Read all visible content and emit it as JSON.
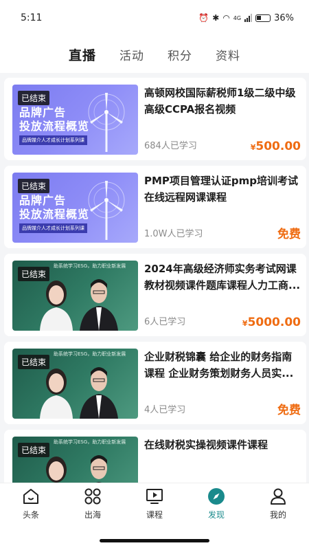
{
  "status": {
    "time": "5:11",
    "battery": "36%",
    "network": "4G"
  },
  "tabs": [
    {
      "label": "直播",
      "active": true
    },
    {
      "label": "活动",
      "active": false
    },
    {
      "label": "积分",
      "active": false
    },
    {
      "label": "资料",
      "active": false
    }
  ],
  "courses": [
    {
      "badge": "已结束",
      "thumb": {
        "style": "purple",
        "line1": "品牌广告",
        "line2": "投放流程概览",
        "sub": "品牌媒介人才成长计划系列课"
      },
      "title": "高顿网校国际薪税师1级二级中级高级CCPA报名视频",
      "learners": "684人已学习",
      "currency": "¥",
      "price": "500.00"
    },
    {
      "badge": "已结束",
      "thumb": {
        "style": "purple",
        "line1": "品牌广告",
        "line2": "投放流程概览",
        "sub": "品牌媒介人才成长计划系列课"
      },
      "title": "PMP项目管理认证pmp培训考试在线远程网课课程",
      "learners": "1.0W人已学习",
      "currency": "",
      "price": "免费"
    },
    {
      "badge": "已结束",
      "thumb": {
        "style": "green",
        "top": "助系统学习ESG，助力职业新发展"
      },
      "title": "2024年高级经济师实务考试网课教材视频课件题库课程人力工商...",
      "learners": "6人已学习",
      "currency": "¥",
      "price": "5000.00"
    },
    {
      "badge": "已结束",
      "thumb": {
        "style": "green",
        "top": "助系统学习ESG，助力职业新发展"
      },
      "title": "企业财税锦囊 给企业的财务指南课程 企业财务策划财务人员实...",
      "learners": "4人已学习",
      "currency": "",
      "price": "免费"
    },
    {
      "badge": "已结束",
      "thumb": {
        "style": "green",
        "top": "助系统学习ESG，助力职业新发展"
      },
      "title": "在线财税实操视频课件课程",
      "learners": "",
      "currency": "",
      "price": ""
    }
  ],
  "nav": [
    {
      "label": "头条",
      "icon": "home-icon",
      "active": false
    },
    {
      "label": "出海",
      "icon": "grid-icon",
      "active": false
    },
    {
      "label": "课程",
      "icon": "video-screen-icon",
      "active": false
    },
    {
      "label": "发现",
      "icon": "compass-icon",
      "active": true
    },
    {
      "label": "我的",
      "icon": "person-icon",
      "active": false
    }
  ],
  "colors": {
    "accent": "#1a8a8c",
    "price": "#ef6c12",
    "purple": "#8d8cf7",
    "green": "#2f7a63"
  }
}
